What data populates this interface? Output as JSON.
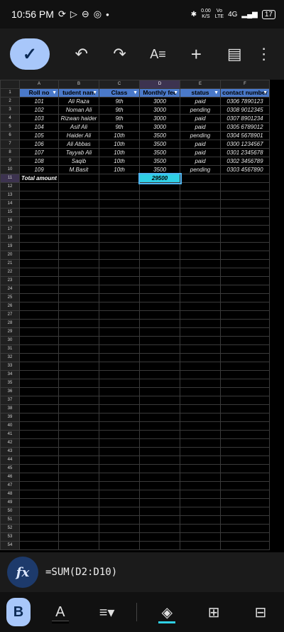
{
  "status_bar": {
    "time": "10:56 PM",
    "net_speed_top": "0.00",
    "net_speed_bottom": "K/S",
    "volte_top": "Vo",
    "volte_bottom": "LTE",
    "network": "4G",
    "battery": "17"
  },
  "formula_bar": {
    "formula": "=SUM(D2:D10)",
    "fx_label": "fx"
  },
  "columns": [
    "A",
    "B",
    "C",
    "D",
    "E",
    "F"
  ],
  "rows": [
    [
      "Roll no",
      "tudent nam",
      "Class",
      "Monthly fee",
      "status",
      "contact number"
    ],
    [
      "101",
      "Ali Raza",
      "9th",
      "3000",
      "paid",
      "0306 7890123"
    ],
    [
      "102",
      "Noman Ali",
      "9th",
      "3000",
      "pending",
      "0308 9012345"
    ],
    [
      "103",
      "Rizwan haider",
      "9th",
      "3000",
      "paid",
      "0307 8901234"
    ],
    [
      "104",
      "Asif Ali",
      "9th",
      "3000",
      "paid",
      "0305 6789012"
    ],
    [
      "105",
      "Haider Ali",
      "10th",
      "3500",
      "pending",
      "0304 5678901"
    ],
    [
      "106",
      "Ali Abbas",
      "10th",
      "3500",
      "paid",
      "0300 1234567"
    ],
    [
      "107",
      "Tayyab Ali",
      "10th",
      "3500",
      "paid",
      "0301 2345678"
    ],
    [
      "108",
      "Saqib",
      "10th",
      "3500",
      "paid",
      "0302 3456789"
    ],
    [
      "109",
      "M.Basit",
      "10th",
      "3500",
      "pending",
      "0303 4567890"
    ],
    [
      "Total amount",
      "",
      "",
      "29500",
      "",
      ""
    ]
  ],
  "visible_row_count": 54,
  "active_cell": "D11",
  "colors": {
    "header_fill": "#4a79c9",
    "active_fill": "#2fd0e5",
    "accent": "#a8c7fa"
  }
}
